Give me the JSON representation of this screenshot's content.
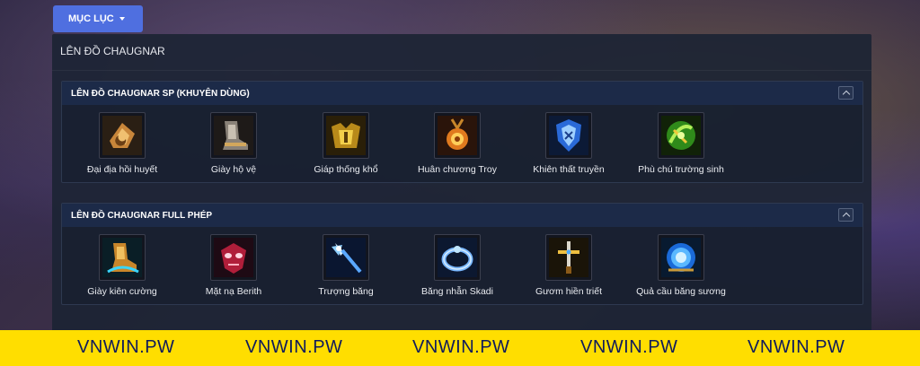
{
  "menu": {
    "label": "MỤC LỤC"
  },
  "panel": {
    "title": "LÊN ĐỒ CHAUGNAR"
  },
  "sections": [
    {
      "title": "LÊN ĐỒ CHAUGNAR SP (KHUYÊN DÙNG)",
      "items": [
        {
          "label": "Đại địa hồi huyết",
          "icon": "earth-heal-icon"
        },
        {
          "label": "Giày hộ vệ",
          "icon": "guardian-boots-icon"
        },
        {
          "label": "Giáp thống khổ",
          "icon": "agony-armor-icon"
        },
        {
          "label": "Huân chương Troy",
          "icon": "troy-medal-icon"
        },
        {
          "label": "Khiên thất truyền",
          "icon": "lost-shield-icon"
        },
        {
          "label": "Phù chú trường sinh",
          "icon": "longevity-talisman-icon"
        }
      ]
    },
    {
      "title": "LÊN ĐỒ CHAUGNAR FULL PHÉP",
      "items": [
        {
          "label": "Giày kiên cường",
          "icon": "resilient-boots-icon"
        },
        {
          "label": "Mặt nạ Berith",
          "icon": "berith-mask-icon"
        },
        {
          "label": "Trượng băng",
          "icon": "ice-staff-icon"
        },
        {
          "label": "Băng nhẫn Skadi",
          "icon": "skadi-ring-icon"
        },
        {
          "label": "Gươm hiền triết",
          "icon": "sage-sword-icon"
        },
        {
          "label": "Quả cầu băng sương",
          "icon": "frost-orb-icon"
        }
      ]
    }
  ],
  "banner": {
    "text": [
      "VNWIN.PW",
      "VNWIN.PW",
      "VNWIN.PW",
      "VNWIN.PW",
      "VNWIN.PW"
    ],
    "color": "#ffde00"
  }
}
